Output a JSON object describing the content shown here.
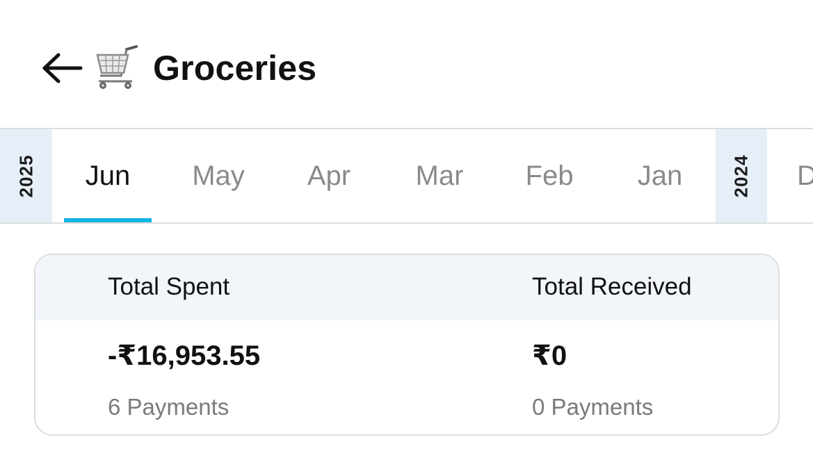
{
  "header": {
    "back_icon": "arrow-left-icon",
    "category_icon": "shopping-cart-icon",
    "title": "Groceries"
  },
  "months": {
    "year_current": "2025",
    "year_previous": "2024",
    "items": [
      {
        "label": "Jun",
        "active": true
      },
      {
        "label": "May",
        "active": false
      },
      {
        "label": "Apr",
        "active": false
      },
      {
        "label": "Mar",
        "active": false
      },
      {
        "label": "Feb",
        "active": false
      },
      {
        "label": "Jan",
        "active": false
      },
      {
        "label": "D",
        "active": false
      }
    ],
    "accent_color": "#14b4e6"
  },
  "summary": {
    "spent": {
      "label": "Total Spent",
      "amount": "-₹16,953.55",
      "count": "6 Payments"
    },
    "received": {
      "label": "Total Received",
      "amount": "₹0",
      "count": "0 Payments"
    }
  }
}
